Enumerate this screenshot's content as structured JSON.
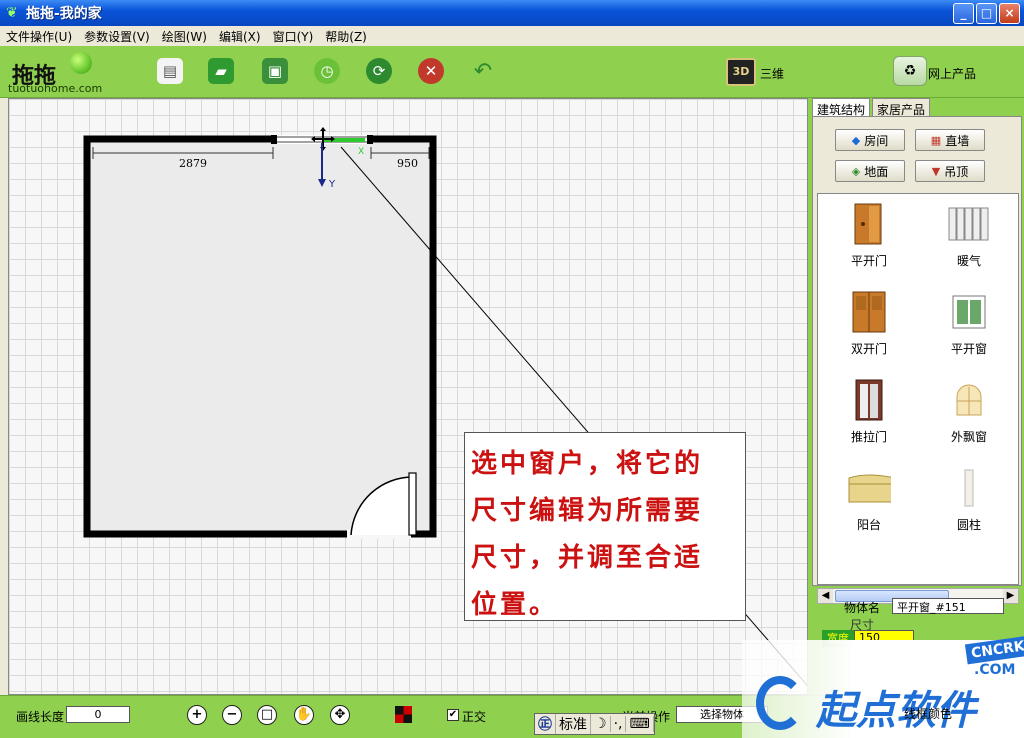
{
  "window": {
    "title": "拖拖-我的家",
    "buttons": [
      "_",
      "□",
      "×"
    ]
  },
  "menu": [
    "文件操作(U)",
    "参数设置(V)",
    "绘图(W)",
    "编辑(X)",
    "窗口(Y)",
    "帮助(Z)"
  ],
  "logo": {
    "mark": "拖拖",
    "site": "tuotuohome.com"
  },
  "toolbar": {
    "icons": [
      "new-icon",
      "open-icon",
      "save-icon",
      "clock-icon",
      "refresh-icon",
      "stop-icon",
      "undo-icon"
    ],
    "view3d_badge": "3D",
    "view3d_label": "三维",
    "online_label": "网上产品"
  },
  "canvas": {
    "dim_left": "2879",
    "dim_right": "950",
    "axis_x": "X",
    "axis_y": "Y"
  },
  "callout": {
    "lines": [
      "选中窗户，将它的",
      "尺寸编辑为所需要",
      "尺寸，并调至合适",
      "位置。"
    ],
    "color": "#cc1111"
  },
  "panel": {
    "tabs": [
      "建筑结构",
      "家居产品"
    ],
    "category_buttons": [
      "房间",
      "直墙",
      "地面",
      "吊顶"
    ],
    "items": [
      "平开门",
      "暖气",
      "双开门",
      "平开窗",
      "推拉门",
      "外飘窗",
      "阳台",
      "圆柱"
    ],
    "object_name_label": "物体名",
    "object_name_value": "平开窗_#151",
    "size_label": "尺寸",
    "width_label": "宽度",
    "width_value": "150"
  },
  "status": {
    "line_length_label": "画线长度",
    "line_length_value": "0",
    "zoom_buttons": [
      "+",
      "−",
      "□",
      "✋",
      "✥"
    ],
    "ortho_label": "正交",
    "ortho_checked": "✔",
    "op_label": "当前操作",
    "op_value": "选择物体",
    "frame_color_label": "线框颜色"
  },
  "ime": [
    "标准",
    "☽",
    "·,",
    "⌨"
  ],
  "watermark": {
    "brand": "起点软件",
    "badge": "CNCRK",
    "domain": ".COM"
  },
  "colors": {
    "toolbar_green": "#8fd14f",
    "callout_red": "#cc1111",
    "title_blue": "#0a54d8"
  }
}
